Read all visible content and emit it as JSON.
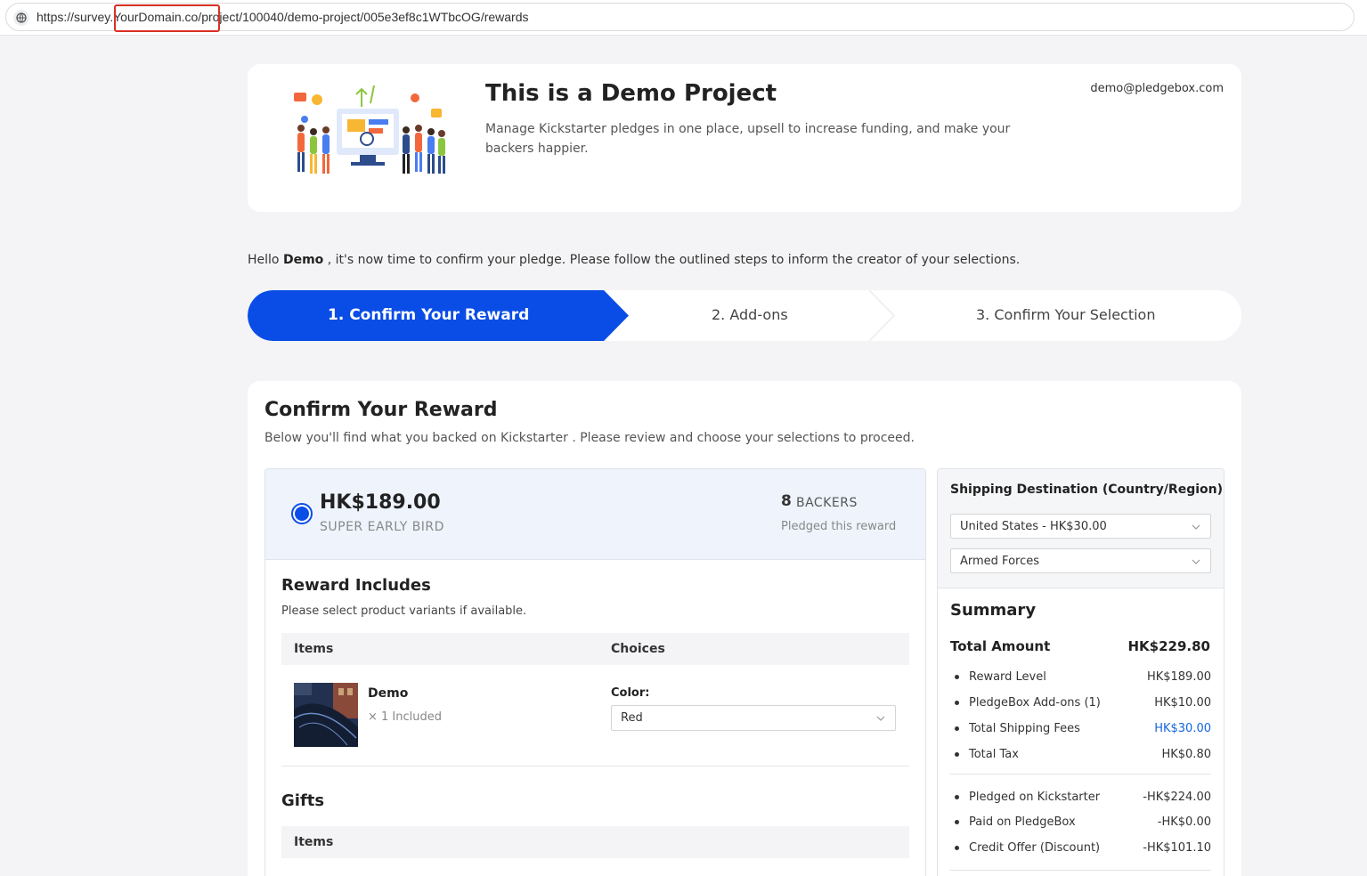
{
  "browser": {
    "url": "https://survey.YourDomain.co/project/100040/demo-project/005e3ef8c1WTbcOG/rewards"
  },
  "header": {
    "title": "This is a Demo Project",
    "description": "Manage Kickstarter pledges in one place, upsell to increase funding, and make your backers happier.",
    "user_email": "demo@pledgebox.com"
  },
  "greeting": {
    "prefix": "Hello",
    "name": "Demo",
    "message": ", it's now time to confirm your pledge. Please follow the outlined steps to inform the creator of your selections."
  },
  "steps": [
    {
      "label": "1. Confirm Your Reward",
      "active": true
    },
    {
      "label": "2. Add-ons",
      "active": false
    },
    {
      "label": "3. Confirm Your Selection",
      "active": false
    }
  ],
  "section": {
    "title": "Confirm Your Reward",
    "subtitle": "Below you'll find what you backed on Kickstarter . Please review and choose your selections to proceed."
  },
  "reward": {
    "price": "HK$189.00",
    "level": "SUPER EARLY BIRD",
    "backers_count": "8",
    "backers_label": "BACKERS",
    "backers_sub": "Pledged this reward",
    "selected": true
  },
  "includes": {
    "title": "Reward Includes",
    "subtitle": "Please select product variants if available.",
    "col_items": "Items",
    "col_choices": "Choices",
    "items": [
      {
        "name": "Demo",
        "qty": "× 1 Included",
        "choice_label": "Color:",
        "choice_value": "Red"
      }
    ]
  },
  "gifts": {
    "title": "Gifts",
    "col_items": "Items"
  },
  "shipping": {
    "title": "Shipping Destination (Country/Region)",
    "country": "United States - HK$30.00",
    "region": "Armed Forces"
  },
  "summary": {
    "title": "Summary",
    "total_label": "Total Amount",
    "total_value": "HK$229.80",
    "rows": [
      {
        "label": "Reward Level",
        "value": "HK$189.00"
      },
      {
        "label": "PledgeBox Add-ons (1)",
        "value": "HK$10.00"
      },
      {
        "label": "Total Shipping Fees",
        "value": "HK$30.00"
      },
      {
        "label": "Total Tax",
        "value": "HK$0.80"
      }
    ],
    "credits": [
      {
        "label": "Pledged on Kickstarter",
        "value": "-HK$224.00"
      },
      {
        "label": "Paid on PledgeBox",
        "value": "-HK$0.00"
      },
      {
        "label": "Credit Offer (Discount)",
        "value": "-HK$101.10"
      }
    ]
  },
  "colors": {
    "accent": "#0a4de6",
    "link": "#1565e0",
    "page_bg": "#f4f4f6",
    "highlight_box": "#d93025"
  }
}
